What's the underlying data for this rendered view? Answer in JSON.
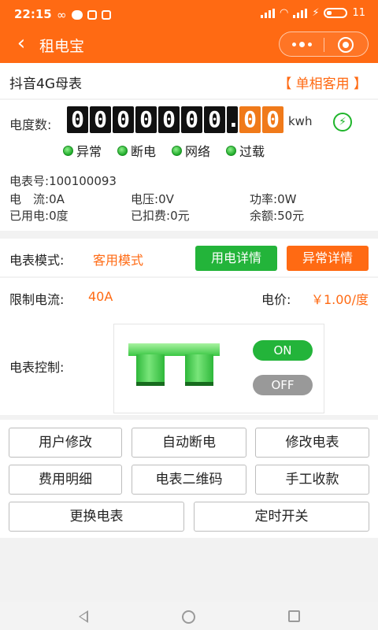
{
  "status": {
    "time": "22:15",
    "battery": "11"
  },
  "nav": {
    "title": "租电宝",
    "back_icon": "back-arrow-icon",
    "more_icon": "more-dots-icon",
    "target_icon": "target-icon"
  },
  "meter": {
    "name": "抖音4G母表",
    "type": "【 单相客用 】",
    "reading_label": "电度数:",
    "digits": [
      "0",
      "0",
      "0",
      "0",
      "0",
      "0",
      "0"
    ],
    "dot": ".",
    "decimals": [
      "0",
      "0"
    ],
    "unit": "kwh",
    "indicators": [
      "异常",
      "断电",
      "网络",
      "过载"
    ],
    "id_label": "电表号:",
    "id": "100100093",
    "current_label": "电　流:",
    "current": "0A",
    "voltage_label": "电压:",
    "voltage": "0V",
    "power_label": "功率:",
    "power": "0W",
    "used_label": "已用电:",
    "used": "0度",
    "deducted_label": "已扣费:",
    "deducted": "0元",
    "balance_label": "余额:",
    "balance": "50元"
  },
  "mode": {
    "label": "电表模式:",
    "value": "客用模式",
    "detail_btn": "用电详情",
    "abnormal_btn": "异常详情"
  },
  "limit": {
    "label": "限制电流:",
    "value": "40A",
    "price_label": "电价:",
    "price": "￥1.00/度"
  },
  "control": {
    "label": "电表控制:",
    "on": "ON",
    "off": "OFF"
  },
  "actions": [
    "用户修改",
    "自动断电",
    "修改电表",
    "费用明细",
    "电表二维码",
    "手工收款",
    "更换电表",
    "定时开关"
  ],
  "colors": {
    "primary": "#ff6a13",
    "green": "#23b43a"
  }
}
